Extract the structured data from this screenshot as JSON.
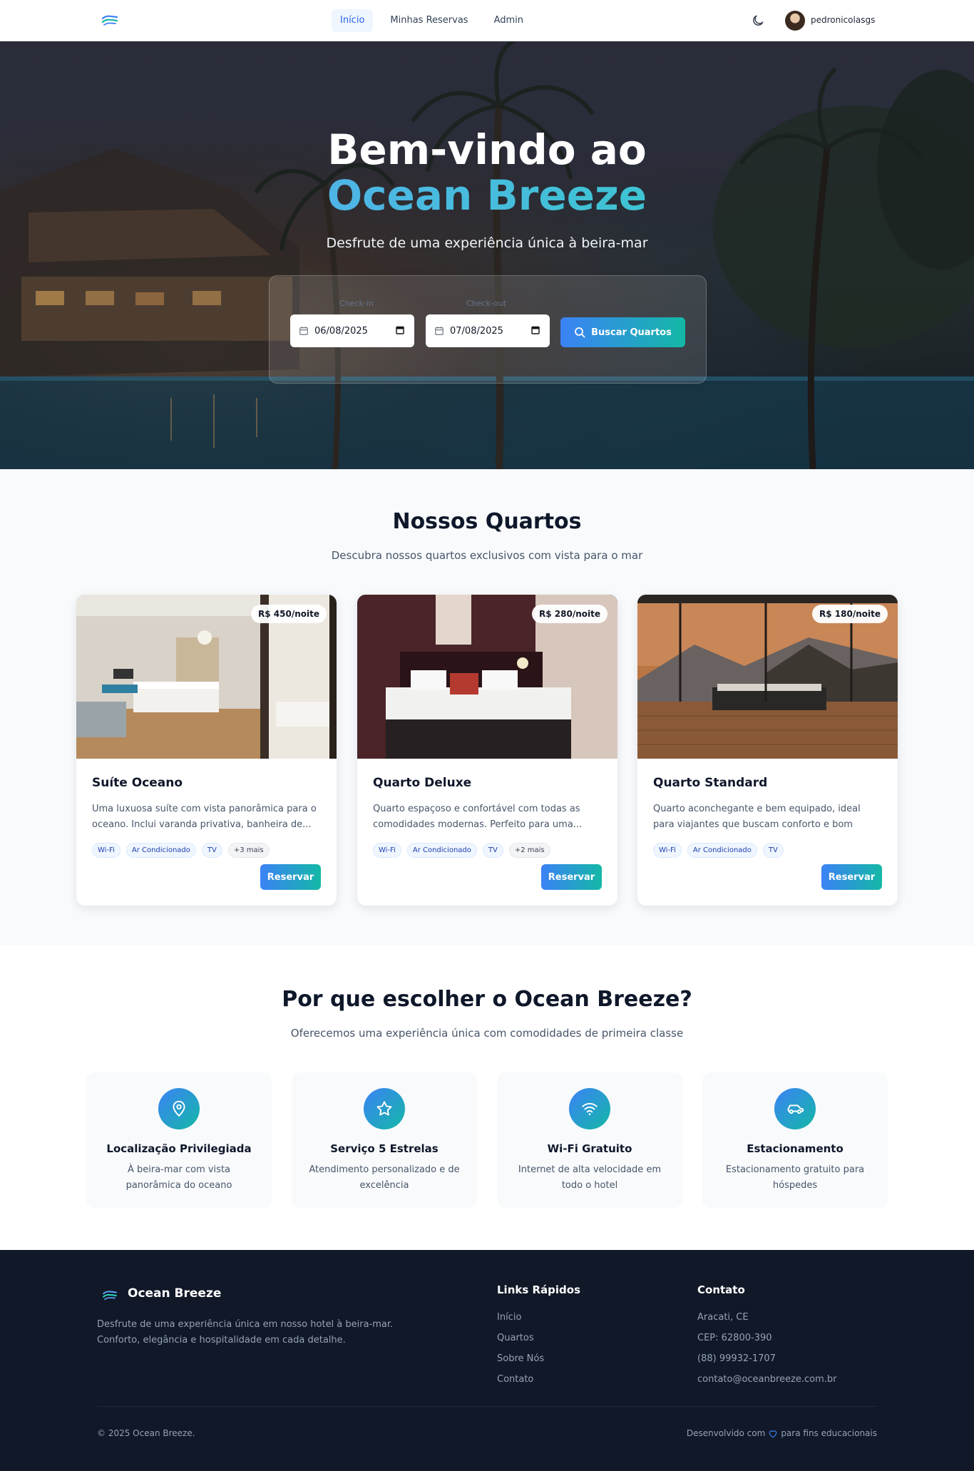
{
  "nav": {
    "links": [
      {
        "label": "Início",
        "active": true
      },
      {
        "label": "Minhas Reservas",
        "active": false
      },
      {
        "label": "Admin",
        "active": false
      }
    ],
    "username": "pedronicolasgs",
    "theme_icon": "moon-icon",
    "logo_icon": "waves-icon"
  },
  "hero": {
    "title_line1": "Bem-vindo ao",
    "title_line2": "Ocean Breeze",
    "subtitle": "Desfrute de uma experiência única à beira-mar",
    "checkin_label": "Check-in",
    "checkin_value": "06/08/2025",
    "checkout_label": "Check-out",
    "checkout_value": "07/08/2025",
    "search_button": "Buscar Quartos"
  },
  "rooms": {
    "title": "Nossos Quartos",
    "subtitle": "Descubra nossos quartos exclusivos com vista para o mar",
    "items": [
      {
        "name": "Suíte Oceano",
        "price": "R$ 450/noite",
        "description": "Uma luxuosa suíte com vista panorâmica para o oceano. Inclui varanda privativa, banheira de...",
        "tags": [
          "Wi-Fi",
          "Ar Condicionado",
          "TV"
        ],
        "more": "+3 mais",
        "button": "Reservar"
      },
      {
        "name": "Quarto Deluxe",
        "price": "R$ 280/noite",
        "description": "Quarto espaçoso e confortável com todas as comodidades modernas. Perfeito para uma...",
        "tags": [
          "Wi-Fi",
          "Ar Condicionado",
          "TV"
        ],
        "more": "+2 mais",
        "button": "Reservar"
      },
      {
        "name": "Quarto Standard",
        "price": "R$ 180/noite",
        "description": "Quarto aconchegante e bem equipado, ideal para viajantes que buscam conforto e bom custo-...",
        "tags": [
          "Wi-Fi",
          "Ar Condicionado",
          "TV"
        ],
        "more": "",
        "button": "Reservar"
      }
    ]
  },
  "features": {
    "title": "Por que escolher o Ocean Breeze?",
    "subtitle": "Oferecemos uma experiência única com comodidades de primeira classe",
    "items": [
      {
        "icon": "map-pin-icon",
        "title": "Localização Privilegiada",
        "description": "À beira-mar com vista panorâmica do oceano"
      },
      {
        "icon": "star-icon",
        "title": "Serviço 5 Estrelas",
        "description": "Atendimento personalizado e de excelência"
      },
      {
        "icon": "wifi-icon",
        "title": "Wi-Fi Gratuito",
        "description": "Internet de alta velocidade em todo o hotel"
      },
      {
        "icon": "car-icon",
        "title": "Estacionamento",
        "description": "Estacionamento gratuito para hóspedes"
      }
    ]
  },
  "footer": {
    "brand": "Ocean Breeze",
    "description": "Desfrute de uma experiência única em nosso hotel à beira-mar. Conforto, elegância e hospitalidade em cada detalhe.",
    "links_title": "Links Rápidos",
    "links": [
      "Início",
      "Quartos",
      "Sobre Nós",
      "Contato"
    ],
    "contact_title": "Contato",
    "contact": [
      "Aracati, CE",
      "CEP: 62800-390",
      "(88) 99932-1707",
      "contato@oceanbreeze.com.br"
    ],
    "copyright": "© 2025 Ocean Breeze.",
    "dev_before": "Desenvolvido com",
    "dev_after": "para fins educacionais"
  },
  "colors": {
    "accent_start": "#3b82f6",
    "accent_end": "#14b8a6",
    "footer_bg": "#111827",
    "section_bg": "#f8fafc"
  }
}
